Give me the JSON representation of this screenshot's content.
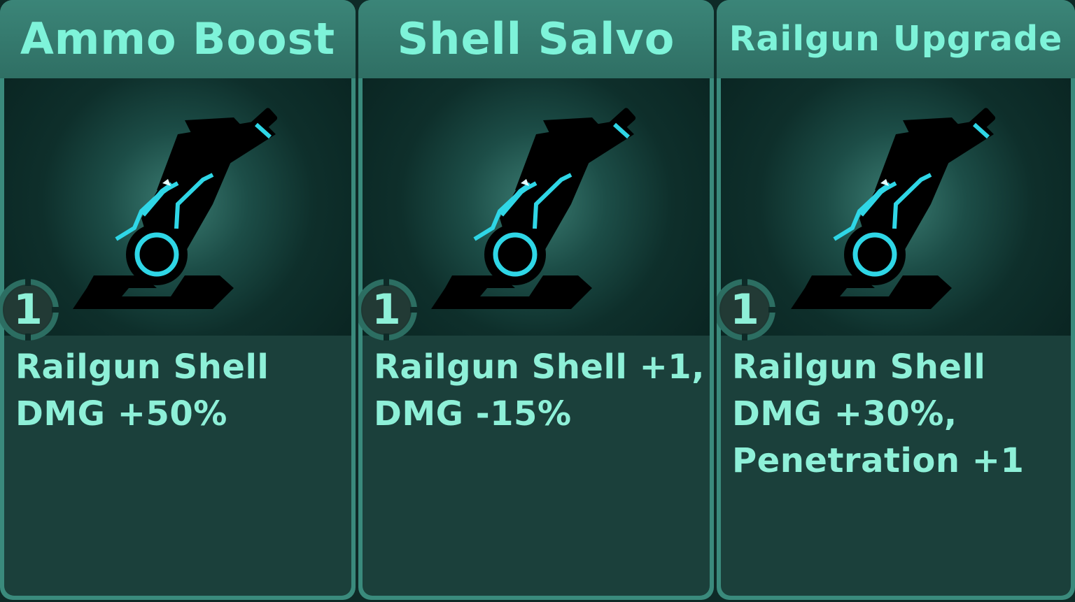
{
  "cards": [
    {
      "title": "Ammo Boost",
      "level": "1",
      "description": [
        "Railgun Shell",
        "DMG +50%"
      ],
      "icon": "railgun-cannon-icon"
    },
    {
      "title": "Shell Salvo",
      "level": "1",
      "description": [
        "Railgun Shell +1,",
        "DMG -15%"
      ],
      "icon": "railgun-cannon-icon"
    },
    {
      "title": "Railgun Upgrade",
      "level": "1",
      "description": [
        "Railgun Shell",
        "DMG +30%,",
        "Penetration +1"
      ],
      "icon": "railgun-cannon-icon"
    }
  ],
  "colors": {
    "card_frame": "#3a8a7c",
    "title_text": "#7ef3d9",
    "body_bg": "#1b403b",
    "text": "#8ef0d8",
    "cannon_glow": "#2fd6e6"
  }
}
